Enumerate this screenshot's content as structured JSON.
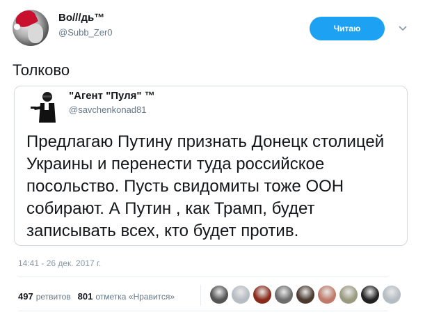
{
  "author": {
    "name": "Во///дь™",
    "handle": "@Subb_Zer0",
    "avatar_icon": "santa-hat-avatar"
  },
  "follow_button": {
    "label": "Читаю",
    "color": "#1da1f2"
  },
  "tweet": {
    "text": "Толково"
  },
  "quoted_tweet": {
    "author_name": "\"Агент \"Пуля\" ™",
    "author_handle": "@savchenkonad81",
    "avatar_icon": "gunman-silhouette-avatar",
    "text": "Предлагаю Путину признать Донецк столицей Украины и перенести туда российское посольство. Пусть свидомиты тоже ООН собирают. А Путин , как Трамп, будет записывать всех, кто будет против."
  },
  "timestamp": "14:41 - 26 дек. 2017 г.",
  "stats": {
    "retweets_count": "497",
    "retweets_label": "ретвитов",
    "likes_count": "801",
    "likes_label": "отметка «Нравится»"
  },
  "likers": [
    {
      "icon": "liker-avatar-1",
      "color": "#555555"
    },
    {
      "icon": "liker-avatar-2",
      "color": "#b5bcc2"
    },
    {
      "icon": "liker-avatar-3",
      "color": "#8a2a1a"
    },
    {
      "icon": "liker-avatar-4",
      "color": "#6d6d6d"
    },
    {
      "icon": "liker-avatar-5",
      "color": "#4a3a30"
    },
    {
      "icon": "liker-avatar-6",
      "color": "#c07a6a"
    },
    {
      "icon": "liker-avatar-7",
      "color": "#9a9a80"
    },
    {
      "icon": "liker-avatar-8",
      "color": "#222222"
    },
    {
      "icon": "liker-avatar-9",
      "color": "#b5bcc2"
    }
  ]
}
